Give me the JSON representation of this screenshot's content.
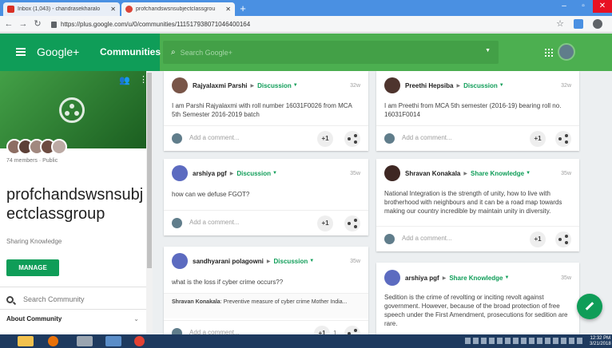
{
  "browser": {
    "tabs": [
      {
        "title": "Inbox (1,043) - chandrasekharalo",
        "active": false
      },
      {
        "title": "profchandswsnsubjectclassgrou",
        "active": true
      }
    ],
    "url": "https://plus.google.com/u/0/communities/111517938071046400164"
  },
  "header": {
    "brand": "Google+",
    "section": "Communities",
    "search_placeholder": "Search Google+"
  },
  "community": {
    "members": "74 members · Public",
    "name": "profchandswsnsubjectclassgroup",
    "tagline": "Sharing Knowledge",
    "manage_label": "MANAGE",
    "search_placeholder": "Search Community",
    "about_label": "About Community"
  },
  "posts": [
    {
      "author": "Rajyalaxmi Parshi",
      "category": "Discussion",
      "time": "32w",
      "text": "I am Parshi Rajyalaxmi with roll number 16031F0026 from MCA 5th Semester 2016-2019 batch",
      "comment_placeholder": "Add a comment...",
      "plus_label": "+1"
    },
    {
      "author": "arshiya pgf",
      "category": "Discussion",
      "time": "35w",
      "text": "how can we defuse FGOT?",
      "comment_placeholder": "Add a comment...",
      "plus_label": "+1"
    },
    {
      "author": "sandhyarani polagowni",
      "category": "Discussion",
      "time": "35w",
      "text": "what is the loss if cyber crime occurs??",
      "comment_author": "Shravan Konakala",
      "comment_text": ": Preventive measure of cyber crime Mother India...",
      "comment_placeholder": "Add a comment...",
      "plus_label": "+1",
      "plus_count": "1"
    },
    {
      "author": "Preethi Hepsiba",
      "category": "Discussion",
      "time": "32w",
      "text": "I am Preethi from MCA 5th semester (2016-19) bearing roll no. 16031F0014",
      "comment_placeholder": "Add a comment...",
      "plus_label": "+1"
    },
    {
      "author": "Shravan Konakala",
      "category": "Share Knowledge",
      "time": "35w",
      "text": "National Integration is the strength of unity, how to live with brotherhood with neighbours and it can be a road map towards making our country incredible by maintain unity in diversity.",
      "comment_placeholder": "Add a comment...",
      "plus_label": "+1"
    },
    {
      "author": "arshiya pgf",
      "category": "Share Knowledge",
      "time": "35w",
      "text": "Sedition is the crime of revolting or inciting revolt against government. However, because of the broad protection of free speech under the First Amendment, prosecutions for sedition are rare."
    }
  ],
  "taskbar": {
    "time": "12:32 PM",
    "date": "3/21/2018"
  },
  "colors": {
    "accent": "#0f9d58",
    "header": "#4caf50"
  }
}
